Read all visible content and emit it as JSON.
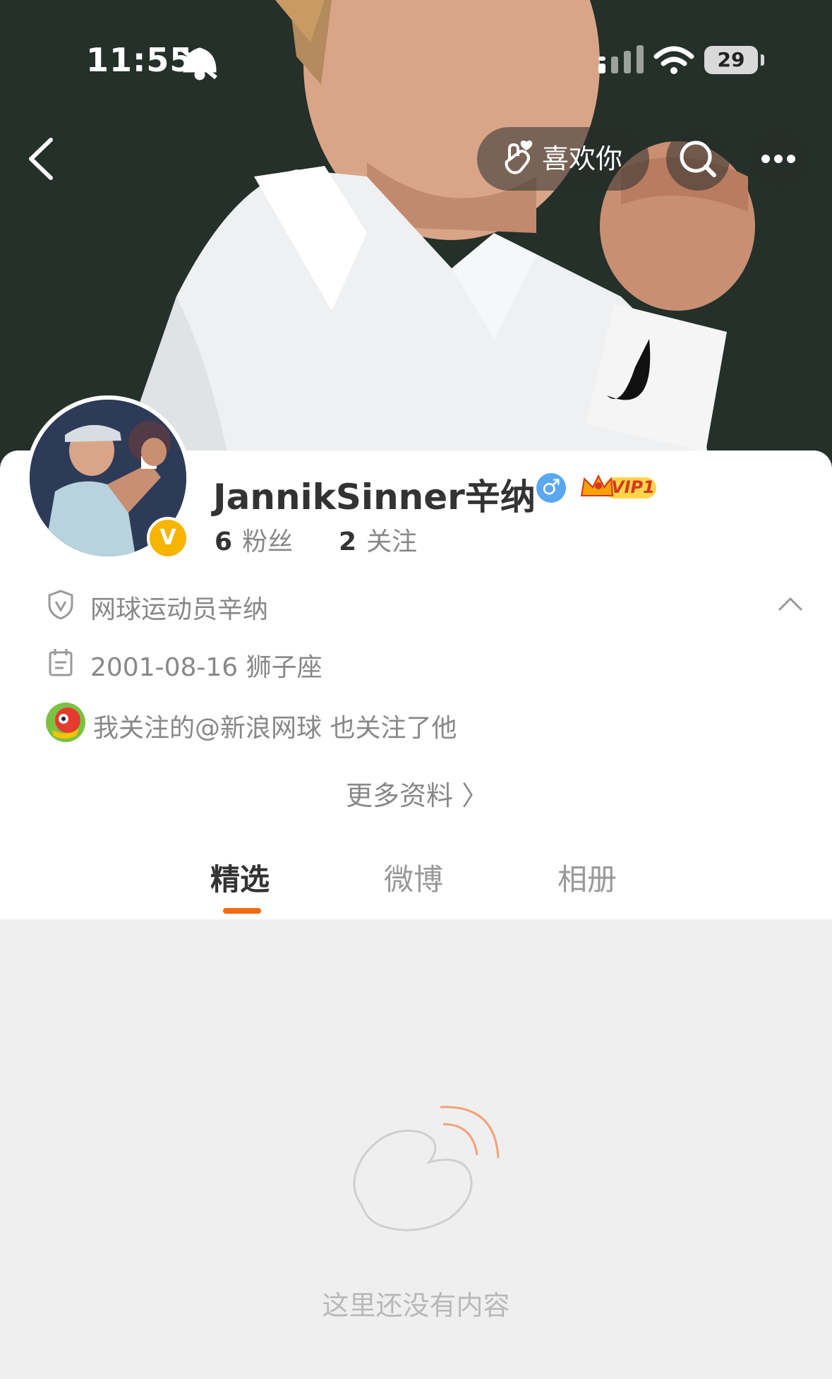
{
  "status_bar": {
    "time": "11:55",
    "battery": "29",
    "icons": [
      "bell-slash-icon",
      "signal-icon",
      "wifi-icon",
      "battery-icon"
    ]
  },
  "nav": {
    "like_label": "喜欢你",
    "icons": [
      "back-icon",
      "hand-heart-icon",
      "search-icon",
      "more-icon"
    ]
  },
  "profile": {
    "name": "JannikSinner辛纳",
    "gender_symbol": "♂",
    "vip_label": "VIP1",
    "verified_badge": "V",
    "followers_count": "6",
    "followers_label": "粉丝",
    "following_count": "2",
    "following_label": "关注"
  },
  "info": {
    "verification": "网球运动员辛纳",
    "birthday": "2001-08-16 狮子座",
    "mutual": "我关注的@新浪网球 也关注了他",
    "more_label": "更多资料 〉"
  },
  "tabs": [
    {
      "label": "精选",
      "active": true
    },
    {
      "label": "微博",
      "active": false
    },
    {
      "label": "相册",
      "active": false
    }
  ],
  "empty_state": {
    "message": "这里还没有内容"
  },
  "colors": {
    "accent": "#f26a12",
    "verified": "#f7b500",
    "gender": "#5aa9f0",
    "vip": "#d8361e"
  }
}
